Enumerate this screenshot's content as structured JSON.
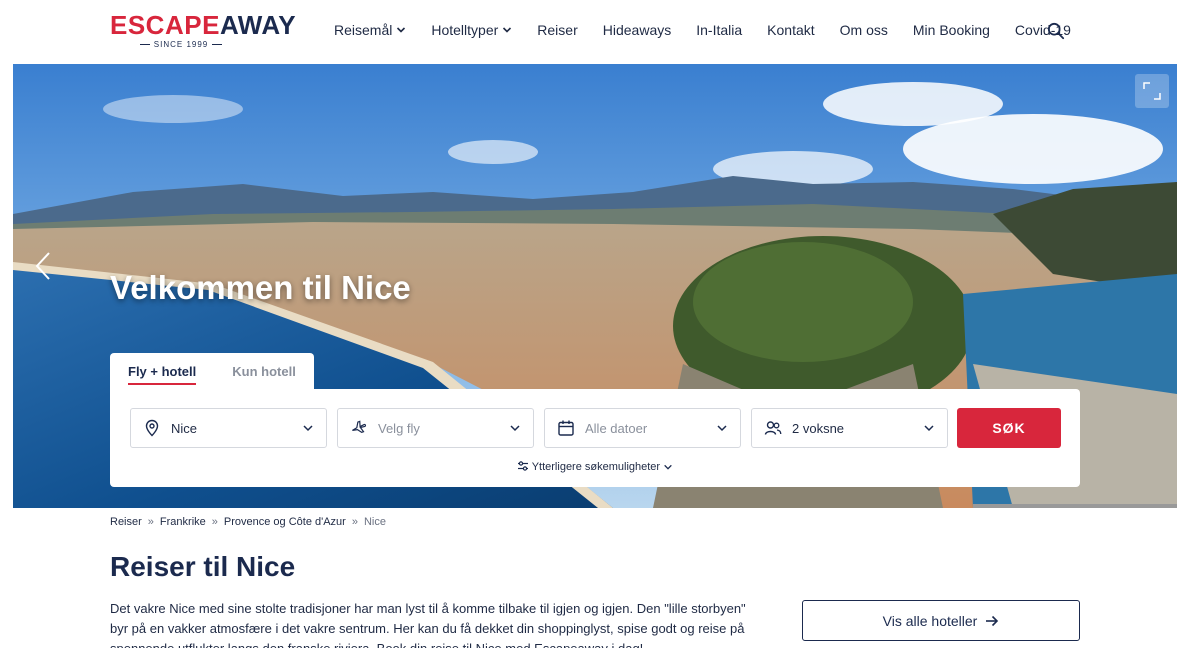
{
  "brand": {
    "name_part1": "ESC",
    "name_part2": "A",
    "name_part3": "PE",
    "name_part4": "AWAY",
    "tagline": "SINCE 1999"
  },
  "nav": [
    {
      "label": "Reisemål",
      "has_dropdown": true
    },
    {
      "label": "Hotelltyper",
      "has_dropdown": true
    },
    {
      "label": "Reiser",
      "has_dropdown": false
    },
    {
      "label": "Hideaways",
      "has_dropdown": false
    },
    {
      "label": "In-Italia",
      "has_dropdown": false
    },
    {
      "label": "Kontakt",
      "has_dropdown": false
    },
    {
      "label": "Om oss",
      "has_dropdown": false
    },
    {
      "label": "Min Booking",
      "has_dropdown": false
    },
    {
      "label": "Covid-19",
      "has_dropdown": false
    }
  ],
  "hero": {
    "title": "Velkommen til Nice"
  },
  "search": {
    "tabs": [
      {
        "label": "Fly + hotell",
        "active": true
      },
      {
        "label": "Kun hotell",
        "active": false
      }
    ],
    "destination": {
      "value": "Nice",
      "icon": "location-pin-icon"
    },
    "flight": {
      "placeholder": "Velg fly",
      "icon": "plane-icon"
    },
    "dates": {
      "placeholder": "Alle datoer",
      "icon": "calendar-icon"
    },
    "guests": {
      "value": "2 voksne",
      "icon": "users-icon"
    },
    "submit_label": "SØK",
    "more_options": "Ytterligere søkemuligheter"
  },
  "breadcrumb": [
    "Reiser",
    "Frankrike",
    "Provence og Côte d'Azur",
    "Nice"
  ],
  "content": {
    "title": "Reiser til Nice",
    "intro": "Det vakre Nice med sine stolte tradisjoner har man lyst til å komme tilbake til igjen og igjen. Den \"lille storbyen\" byr på en vakker atmosfære i det vakre sentrum. Her kan du få dekket din shoppinglyst, spise godt og reise på spennende utflukter langs den franske riviera. Book din reise til Nice med Escapeaway i dag!",
    "all_hotels_label": "Vis alle hoteller"
  },
  "colors": {
    "brand_red": "#d8263c",
    "navy": "#1b2a4e"
  }
}
